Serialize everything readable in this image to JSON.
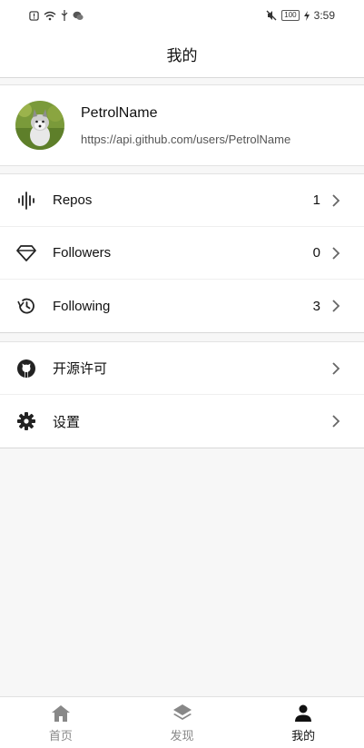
{
  "status_bar": {
    "time": "3:59",
    "battery": "100"
  },
  "header": {
    "title": "我的"
  },
  "profile": {
    "name": "PetrolName",
    "url": "https://api.github.com/users/PetrolName"
  },
  "stats": [
    {
      "label": "Repos",
      "count": "1",
      "icon": "repos-icon"
    },
    {
      "label": "Followers",
      "count": "0",
      "icon": "diamond-icon"
    },
    {
      "label": "Following",
      "count": "3",
      "icon": "history-icon"
    }
  ],
  "settings": [
    {
      "label": "开源许可",
      "icon": "github-icon"
    },
    {
      "label": "设置",
      "icon": "gear-icon"
    }
  ],
  "nav": [
    {
      "label": "首页",
      "icon": "home-icon",
      "active": false
    },
    {
      "label": "发现",
      "icon": "layers-icon",
      "active": false
    },
    {
      "label": "我的",
      "icon": "person-icon",
      "active": true
    }
  ],
  "colors": {
    "background": "#f7f7f7",
    "card": "#ffffff",
    "inactive_nav": "#888888",
    "active_nav": "#111111"
  }
}
